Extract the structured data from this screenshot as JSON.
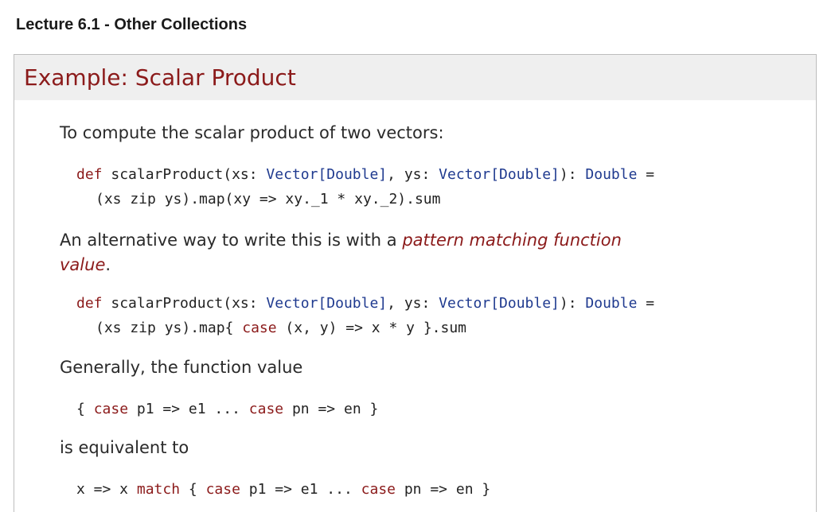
{
  "header": {
    "title": "Lecture 6.1 - Other Collections"
  },
  "slide": {
    "title": "Example: Scalar Product",
    "intro": "To compute the scalar product of two vectors:",
    "code1": {
      "line1": {
        "kw_def": "def",
        "name": " scalarProduct(xs: ",
        "type1": "Vector[Double]",
        "mid": ", ys: ",
        "type2": "Vector[Double]",
        "colon": "): ",
        "ret": "Double",
        "eq": " ="
      },
      "line2": "(xs zip ys).map(xy => xy._1 * xy._2).sum"
    },
    "alt_text_start": "An alternative way to write this is with a ",
    "alt_text_emph": "pattern matching function",
    "alt_text_emph2": "value",
    "alt_text_end": ".",
    "code2": {
      "line1": {
        "kw_def": "def",
        "name": " scalarProduct(xs: ",
        "type1": "Vector[Double]",
        "mid": ", ys: ",
        "type2": "Vector[Double]",
        "colon": "): ",
        "ret": "Double",
        "eq": " ="
      },
      "line2_pre": "(xs zip ys).map{ ",
      "line2_kw": "case",
      "line2_post": " (x, y) => x * y }.sum"
    },
    "general_text": "Generally, the function value",
    "code3": {
      "open": "{ ",
      "case1": "case",
      "part1": " p1 => e1 ... ",
      "case2": "case",
      "part2": " pn => en }"
    },
    "equiv_text": "is equivalent to",
    "code4": {
      "pre": "x => x ",
      "match": "match",
      "open": " { ",
      "case1": "case",
      "part1": " p1 => e1 ... ",
      "case2": "case",
      "part2": " pn => en }"
    }
  }
}
